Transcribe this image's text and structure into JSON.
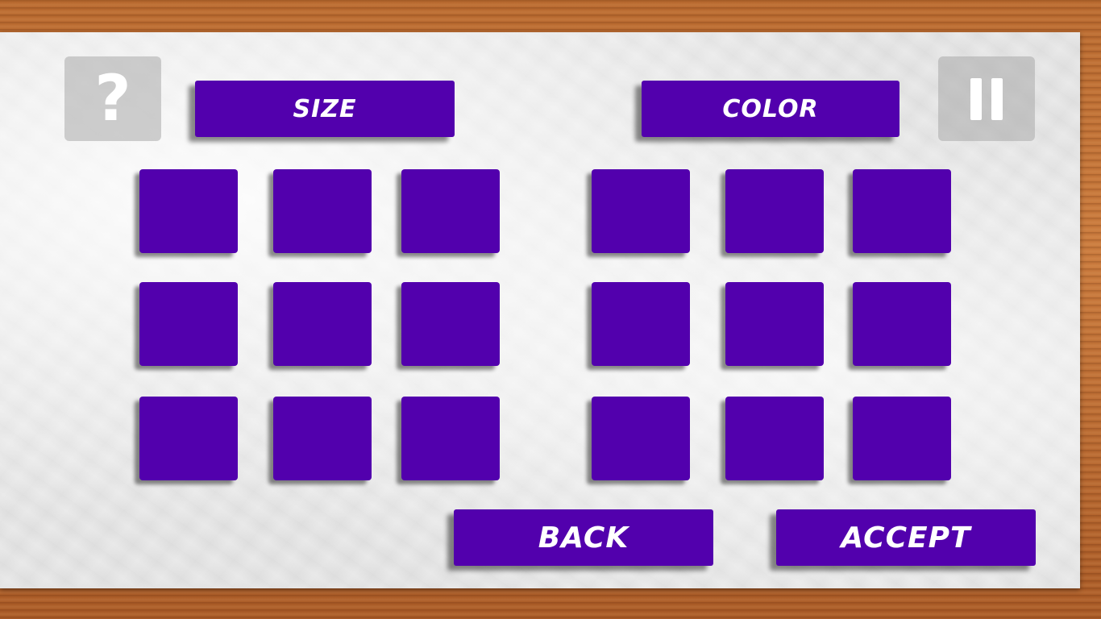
{
  "header": {
    "size_label": "SIZE",
    "color_label": "COLOR",
    "help_symbol": "?"
  },
  "icons": {
    "help": "question-mark-icon",
    "pause": "pause-icon"
  },
  "footer": {
    "back_label": "BACK",
    "accept_label": "ACCEPT"
  },
  "colors": {
    "button": "#5200ad",
    "icon_button": "#aaaaaa",
    "text": "#ffffff"
  },
  "size_grid": {
    "rows": 3,
    "cols": 3
  },
  "color_grid": {
    "rows": 3,
    "cols": 3
  }
}
